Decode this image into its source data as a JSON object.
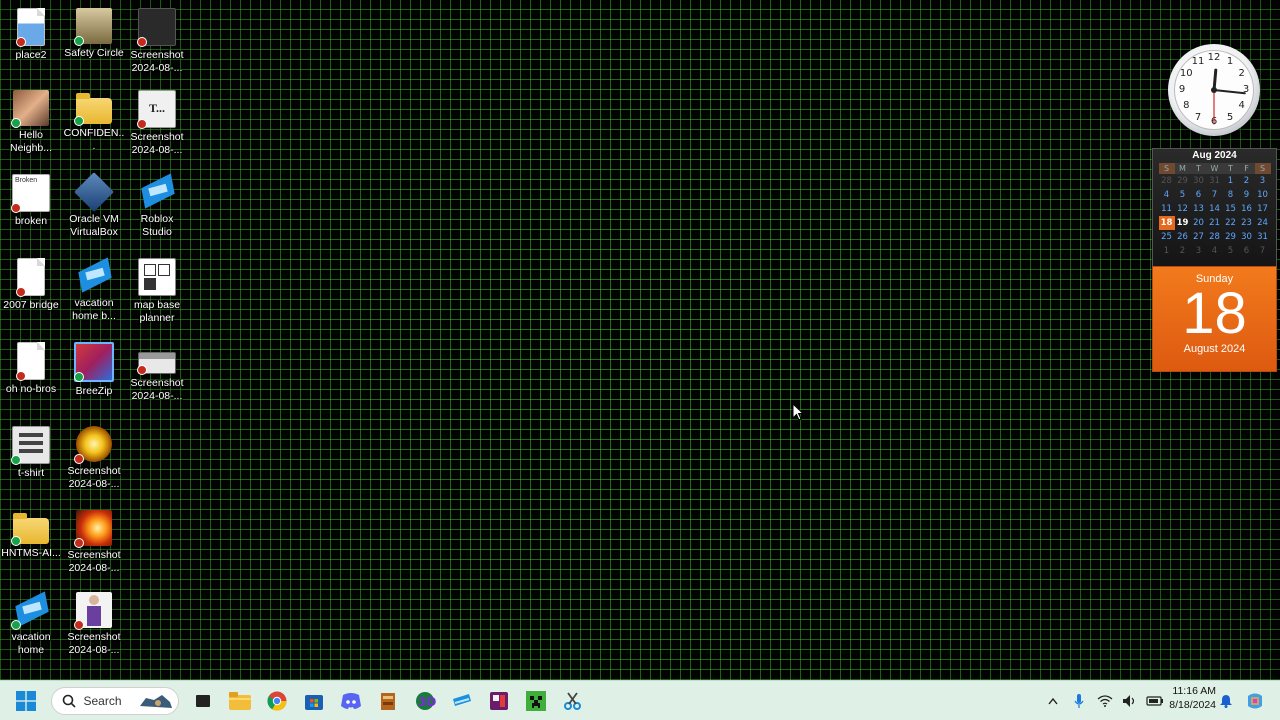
{
  "desktop": {
    "icons": [
      {
        "label": "place2"
      },
      {
        "label": "Safety Circle"
      },
      {
        "label": "Screenshot 2024-08-..."
      },
      {
        "label": "Hello Neighb..."
      },
      {
        "label": "CONFIDEN..."
      },
      {
        "label": "Screenshot 2024-08-..."
      },
      {
        "label": "broken",
        "art": "Broken"
      },
      {
        "label": "Oracle VM VirtualBox"
      },
      {
        "label": "Roblox Studio"
      },
      {
        "label": "2007 bridge"
      },
      {
        "label": "vacation home b..."
      },
      {
        "label": "map base planner"
      },
      {
        "label": "oh no-bros"
      },
      {
        "label": "BreeZip"
      },
      {
        "label": "Screenshot 2024-08-..."
      },
      {
        "label": "t-shirt"
      },
      {
        "label": "Screenshot 2024-08-..."
      },
      {
        "label": "HNTMS-AI..."
      },
      {
        "label": "Screenshot 2024-08-..."
      },
      {
        "label": "vacation home"
      },
      {
        "label": "Screenshot 2024-08-..."
      }
    ],
    "screenshot_art_text": "T..."
  },
  "gadgets": {
    "clock": {
      "numbers": [
        "12",
        "1",
        "2",
        "3",
        "4",
        "5",
        "6",
        "7",
        "8",
        "9",
        "10",
        "11"
      ],
      "time": "11:16"
    },
    "calendar": {
      "header": "Aug 2024",
      "weekdays": [
        "S",
        "M",
        "T",
        "W",
        "T",
        "F",
        "S"
      ],
      "weeks": [
        [
          "28",
          "29",
          "30",
          "31",
          "1",
          "2",
          "3"
        ],
        [
          "4",
          "5",
          "6",
          "7",
          "8",
          "9",
          "10"
        ],
        [
          "11",
          "12",
          "13",
          "14",
          "15",
          "16",
          "17"
        ],
        [
          "18",
          "19",
          "20",
          "21",
          "22",
          "23",
          "24"
        ],
        [
          "25",
          "26",
          "27",
          "28",
          "29",
          "30",
          "31"
        ],
        [
          "1",
          "2",
          "3",
          "4",
          "5",
          "6",
          "7"
        ]
      ],
      "today": "18"
    },
    "date": {
      "weekday": "Sunday",
      "day": "18",
      "month_year": "August 2024"
    }
  },
  "taskbar": {
    "search_placeholder": "Search",
    "apps": [
      "start-icon",
      "search-icon",
      "task-view-icon",
      "file-explorer-icon",
      "chrome-icon",
      "microsoft-store-icon",
      "discord-icon",
      "app-icon-1",
      "app-icon-2",
      "roblox-studio-icon",
      "app-icon-3",
      "minecraft-icon",
      "snipping-tool-icon"
    ],
    "tray": {
      "time": "11:16 AM",
      "date": "8/18/2024"
    }
  },
  "colors": {
    "grid": "#3cc828",
    "taskbar": "#dff0e6",
    "date_orange": "#e7691d",
    "accent_blue": "#1e8fe0"
  }
}
